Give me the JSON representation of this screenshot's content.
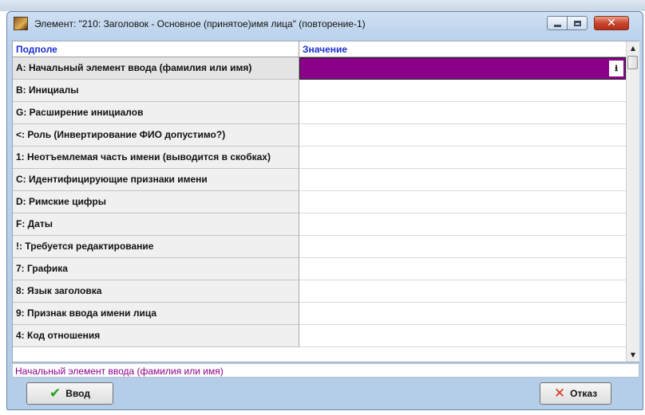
{
  "window": {
    "title": "Элемент: \"210: Заголовок - Основное (принятое)имя лица\" (повторение-1)",
    "icon": "app-icon",
    "controls": {
      "minimize_icon": "minimize-icon",
      "maximize_icon": "maximize-icon",
      "close_icon": "close-icon",
      "close_glyph": "✕"
    }
  },
  "grid": {
    "columns": {
      "subfield": "Подполе",
      "value": "Значение"
    },
    "rows": [
      {
        "label": "A: Начальный элемент ввода (фамилия или имя)",
        "value": "",
        "selected": true
      },
      {
        "label": "B: Инициалы",
        "value": ""
      },
      {
        "label": "G: Расширение инициалов",
        "value": ""
      },
      {
        "label": "<: Роль (Инвертирование ФИО допустимо?)",
        "value": ""
      },
      {
        "label": "1: Неотъемлемая часть имени (выводится в скобках)",
        "value": ""
      },
      {
        "label": "C: Идентифицирующие признаки имени",
        "value": ""
      },
      {
        "label": "D: Римские цифры",
        "value": ""
      },
      {
        "label": "F: Даты",
        "value": ""
      },
      {
        "label": "!: Требуется редактирование",
        "value": ""
      },
      {
        "label": "7: Графика",
        "value": ""
      },
      {
        "label": "8: Язык заголовка",
        "value": ""
      },
      {
        "label": "9: Признак ввода имени лица",
        "value": ""
      },
      {
        "label": "4: Код отношения",
        "value": ""
      }
    ],
    "dropdown_icon": "download-arrow-icon",
    "dropdown_glyph": "⭳",
    "selected_color": "#8b008b",
    "header_color": "#1b2fd0",
    "scrollbar": {
      "up_glyph": "▲",
      "down_glyph": "▼"
    }
  },
  "status": {
    "text": "Начальный элемент ввода (фамилия или имя)",
    "color": "#8b008b"
  },
  "buttons": {
    "ok": {
      "label": "Ввод",
      "icon": "checkmark-icon",
      "glyph": "✔"
    },
    "cancel": {
      "label": "Отказ",
      "icon": "x-icon",
      "glyph": "✕"
    }
  }
}
